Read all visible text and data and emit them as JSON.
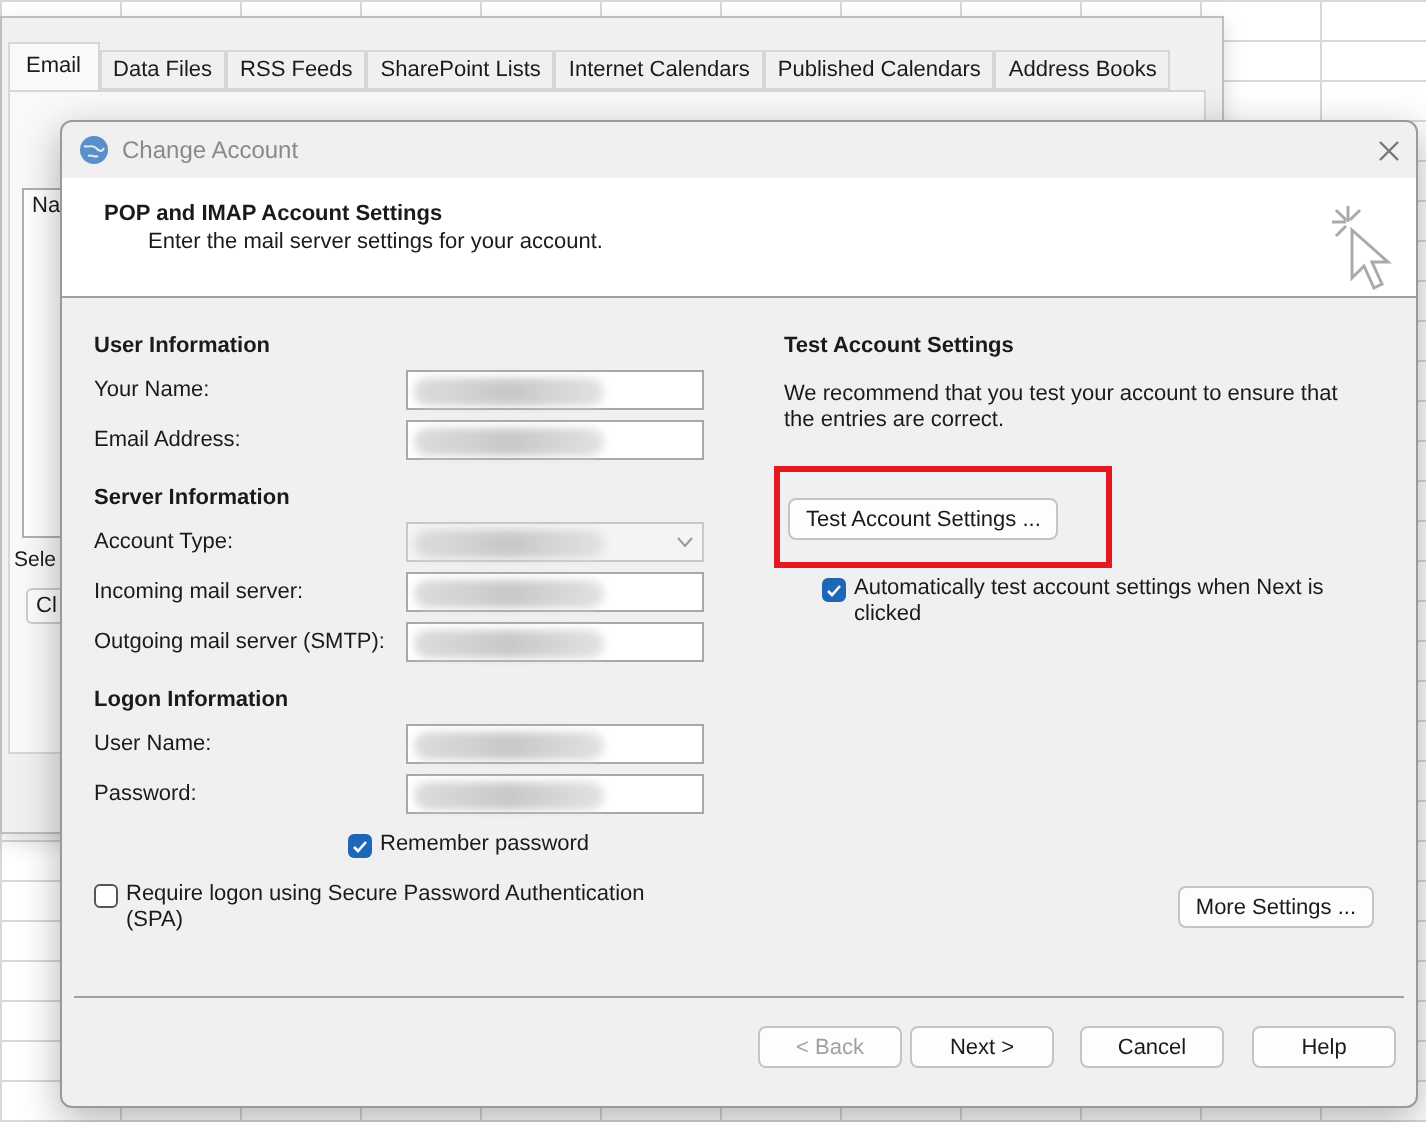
{
  "background_window": {
    "tabs": [
      {
        "label": "Email",
        "selected": true
      },
      {
        "label": "Data Files",
        "selected": false
      },
      {
        "label": "RSS Feeds",
        "selected": false
      },
      {
        "label": "SharePoint Lists",
        "selected": false
      },
      {
        "label": "Internet Calendars",
        "selected": false
      },
      {
        "label": "Published Calendars",
        "selected": false
      },
      {
        "label": "Address Books",
        "selected": false
      }
    ],
    "list_header": "Na",
    "select_label": "Sele",
    "button": "Cl"
  },
  "dialog": {
    "title": "Change Account",
    "header": {
      "title": "POP and IMAP Account Settings",
      "subtitle": "Enter the mail server settings for your account."
    },
    "sections": [
      {
        "heading": "User Information",
        "fields": [
          {
            "label": "Your Name:",
            "kind": "text"
          },
          {
            "label": "Email Address:",
            "kind": "text"
          }
        ]
      },
      {
        "heading": "Server Information",
        "fields": [
          {
            "label": "Account Type:",
            "kind": "dropdown"
          },
          {
            "label": "Incoming mail server:",
            "kind": "text"
          },
          {
            "label": "Outgoing mail server (SMTP):",
            "kind": "text"
          }
        ]
      },
      {
        "heading": "Logon Information",
        "fields": [
          {
            "label": "User Name:",
            "kind": "text"
          },
          {
            "label": "Password:",
            "kind": "text"
          }
        ]
      }
    ],
    "remember_password": {
      "label": "Remember password",
      "checked": true
    },
    "require_spa": {
      "label": "Require logon using Secure Password Authentication (SPA)",
      "checked": false
    },
    "test": {
      "heading": "Test Account Settings",
      "text": "We recommend that you test your account to ensure that the entries are correct.",
      "button": "Test Account Settings ...",
      "auto_test": {
        "label": "Automatically test account settings when Next is clicked",
        "checked": true
      }
    },
    "more_settings": "More Settings ...",
    "buttons": [
      {
        "label": "< Back",
        "disabled": true
      },
      {
        "label": "Next >",
        "disabled": false
      },
      {
        "label": "Cancel",
        "disabled": false
      },
      {
        "label": "Help",
        "disabled": false
      }
    ]
  }
}
